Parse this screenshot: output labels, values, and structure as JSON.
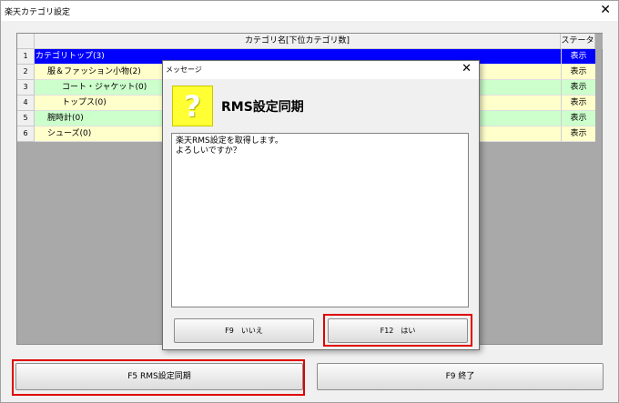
{
  "window": {
    "title": "楽天カテゴリ設定"
  },
  "grid": {
    "headers": {
      "name": "カテゴリ名[下位カテゴリ数]",
      "status": "ステータス"
    },
    "rows": [
      {
        "num": "1",
        "name": "カテゴリトップ(3)",
        "status": "表示"
      },
      {
        "num": "2",
        "name": "服＆ファッション小物(2)",
        "status": "表示"
      },
      {
        "num": "3",
        "name": "コート・ジャケット(0)",
        "status": "表示"
      },
      {
        "num": "4",
        "name": "トップス(0)",
        "status": "表示"
      },
      {
        "num": "5",
        "name": "腕時計(0)",
        "status": "表示"
      },
      {
        "num": "6",
        "name": "シューズ(0)",
        "status": "表示"
      }
    ]
  },
  "buttons": {
    "sync": "F5 RMS設定同期",
    "exit": "F9 終了"
  },
  "dialog": {
    "title": "メッセージ",
    "heading": "RMS設定同期",
    "icon": "question-icon",
    "message_line1": "楽天RMS設定を取得します。",
    "message_line2": "よろしいですか？",
    "no_label": "F9　いいえ",
    "yes_label": "F12　はい"
  },
  "colors": {
    "selected": "#0000ff",
    "row_green": "#ccffcc",
    "row_yellow": "#ffffcc",
    "highlight": "#e00000",
    "icon": "#ffff33"
  }
}
